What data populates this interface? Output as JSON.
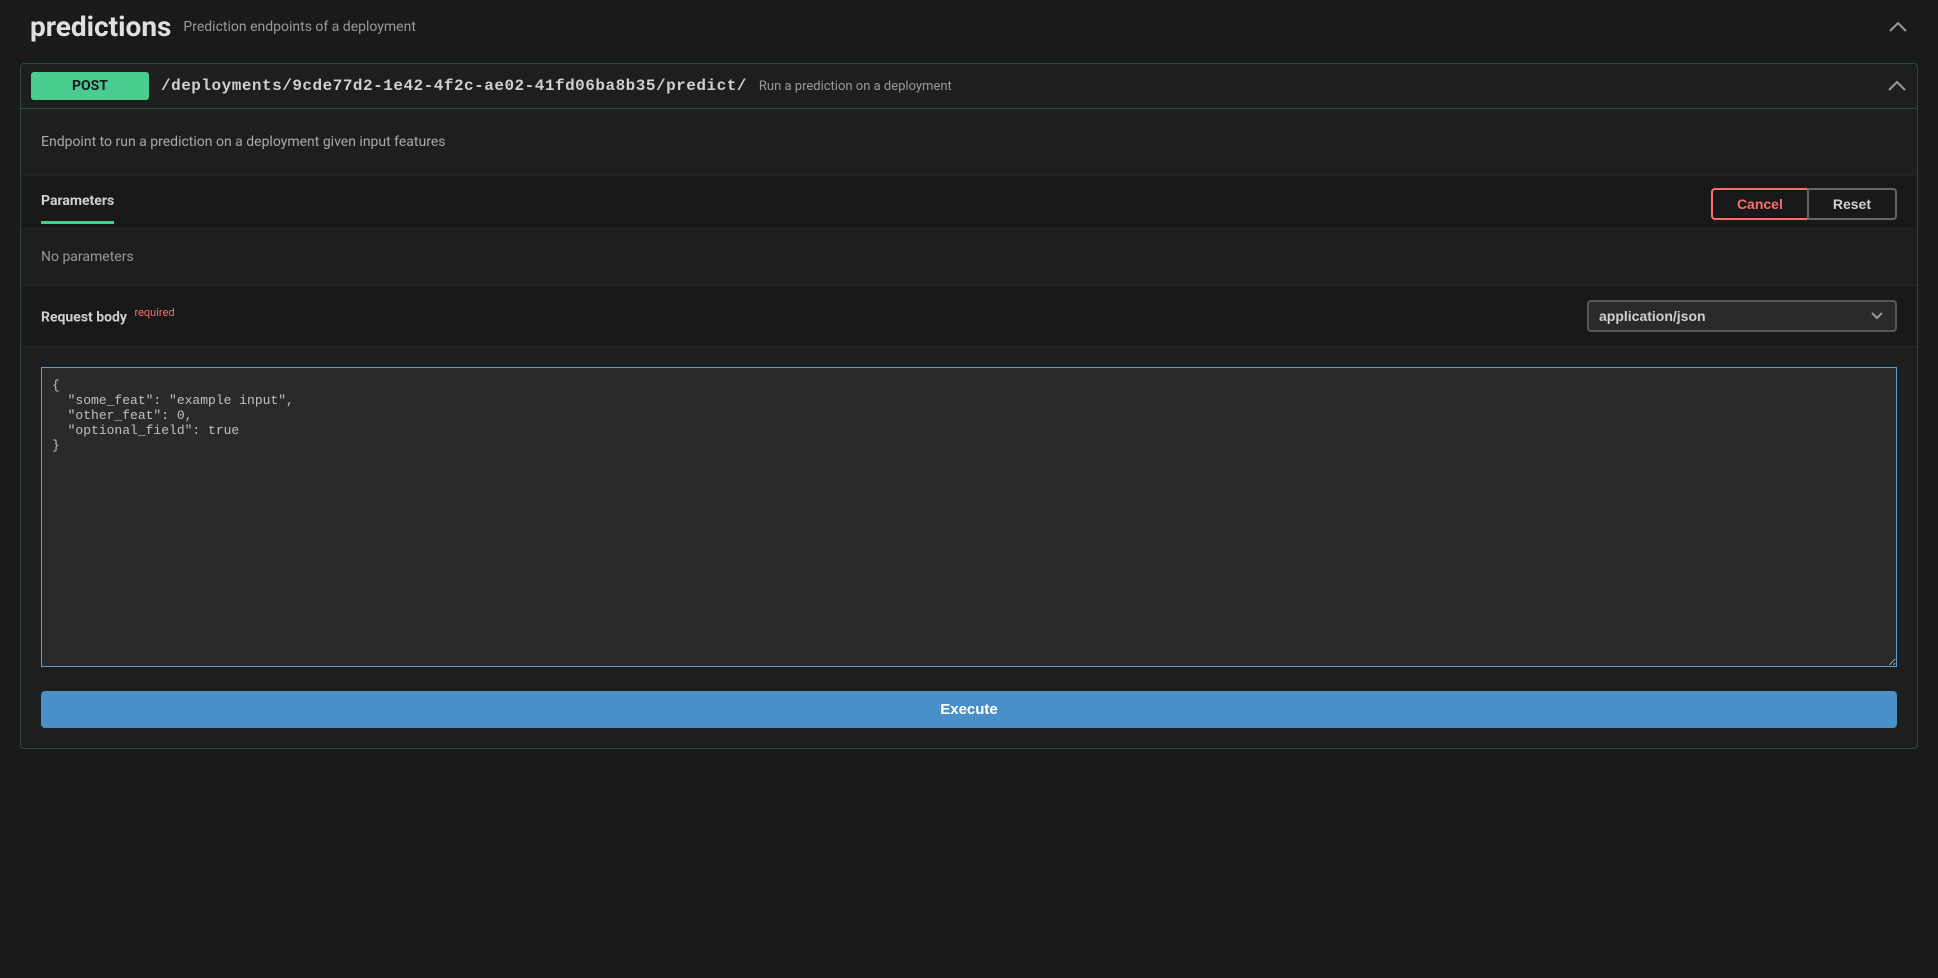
{
  "section": {
    "title": "predictions",
    "description": "Prediction endpoints of a deployment"
  },
  "endpoint": {
    "method": "POST",
    "path": "/deployments/9cde77d2-1e42-4f2c-ae02-41fd06ba8b35/predict/",
    "summary": "Run a prediction on a deployment",
    "description": "Endpoint to run a prediction on a deployment given input features"
  },
  "parameters": {
    "tab_label": "Parameters",
    "cancel_label": "Cancel",
    "reset_label": "Reset",
    "empty_text": "No parameters"
  },
  "request_body": {
    "label": "Request body",
    "required_tag": "required",
    "content_type": "application/json",
    "value": "{\n  \"some_feat\": \"example input\",\n  \"other_feat\": 0,\n  \"optional_field\": true\n}"
  },
  "execute_label": "Execute"
}
